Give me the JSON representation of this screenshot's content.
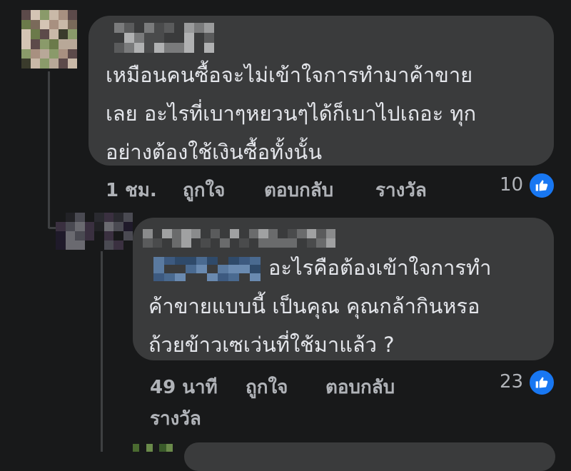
{
  "comments": [
    {
      "text_lines": [
        "เหมือนคนซื้อจะไม่เข้าใจการทำมาค้าขาย",
        "เลย อะไรที่เบาๆหยวนๆได้ก็เบาไปเถอะ ทุก",
        "อย่างต้องใช้เงินซื้อทั้งนั้น"
      ],
      "time": "1 ชม.",
      "like_label": "ถูกใจ",
      "reply_label": "ตอบกลับ",
      "award_label": "รางวัล",
      "reaction_count": "10",
      "reaction_icon": "like-icon"
    },
    {
      "text_lines": [
        "อะไรคือต้องเข้าใจการทำ",
        "ค้าขายแบบนี้ เป็นคุณ คุณกล้ากินหรอ",
        "ถ้วยข้าวเซเว่นที่ใช้มาแล้ว ?"
      ],
      "time": "49 นาที",
      "like_label": "ถูกใจ",
      "reply_label": "ตอบกลับ",
      "award_label": "รางวัล",
      "reaction_count": "23",
      "reaction_icon": "like-icon"
    }
  ],
  "colors": {
    "background": "#18191a",
    "bubble": "#3a3b3c",
    "text": "#e4e6eb",
    "secondary_text": "#b0b3b8",
    "like_blue": "#1877f2"
  }
}
